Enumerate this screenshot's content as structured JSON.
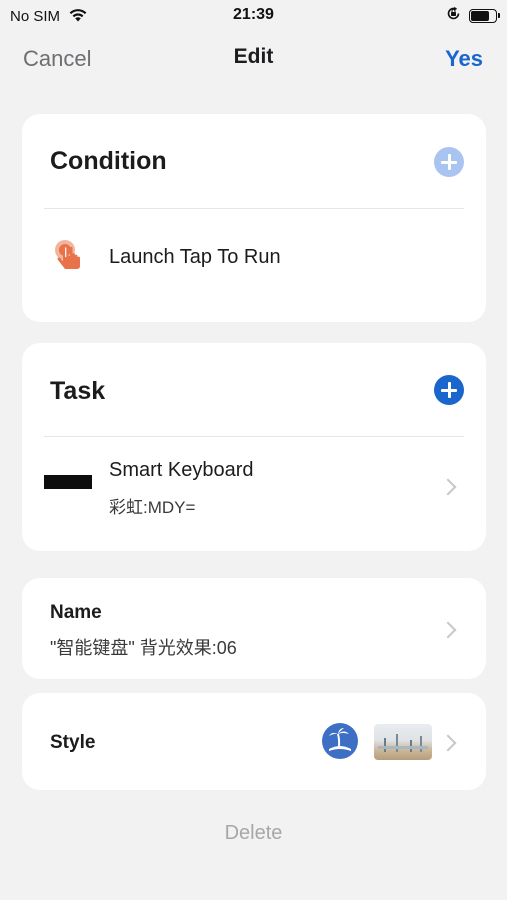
{
  "status_bar": {
    "carrier": "No SIM",
    "time": "21:39",
    "battery_level": 0.8
  },
  "nav": {
    "cancel_label": "Cancel",
    "title": "Edit",
    "yes_label": "Yes"
  },
  "condition": {
    "heading": "Condition",
    "item_label": "Launch Tap To Run"
  },
  "task": {
    "heading": "Task",
    "item_title": "Smart Keyboard",
    "item_subtitle": "彩虹:MDY="
  },
  "name_section": {
    "label": "Name",
    "value": "\"智能键盘\" 背光效果:06"
  },
  "style_section": {
    "label": "Style"
  },
  "delete_label": "Delete",
  "colors": {
    "accent_blue": "#1a66cc",
    "add_button_disabled": "#a9c4f0",
    "add_button_active": "#1a66cc",
    "tap_icon": "#e8734a",
    "delete_text": "#a7a7ab"
  },
  "icons": {
    "condition_icon": "tap-hand-icon",
    "style_icon": "palm-island-icon",
    "style_thumbnail": "wallpaper-thumbnail"
  }
}
